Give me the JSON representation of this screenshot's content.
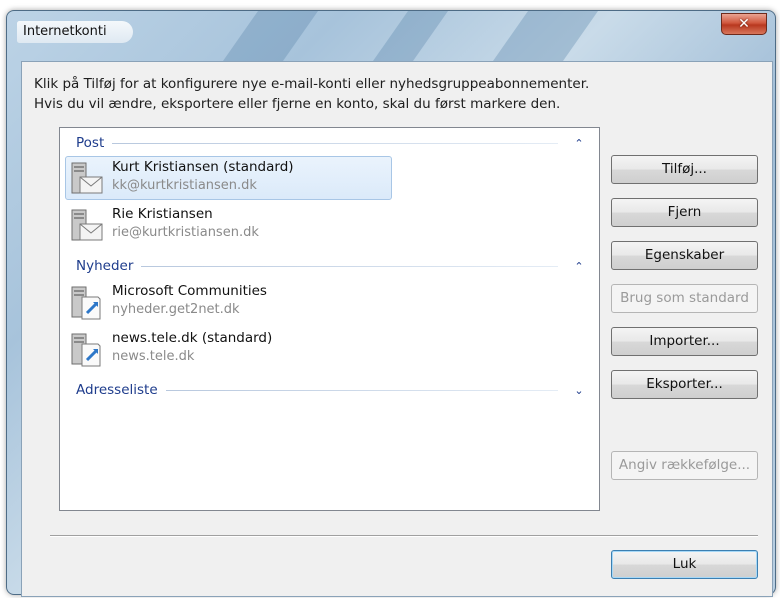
{
  "window": {
    "title": "Internetkonti",
    "close_glyph": "✕"
  },
  "intro": {
    "line1": "Klik på Tilføj for at konfigurere nye e-mail-konti eller nyhedsgruppeabonnementer.",
    "line2": "Hvis du vil ændre, eksportere eller fjerne en konto, skal du først markere den."
  },
  "groups": {
    "post": {
      "title": "Post",
      "chevron": "⌃",
      "chevron_icon": "chevron-up-icon",
      "items": [
        {
          "name": "Kurt Kristiansen (standard)",
          "sub": "kk@kurtkristiansen.dk",
          "icon": "mail-account-icon",
          "selected": true
        },
        {
          "name": "Rie Kristiansen",
          "sub": "rie@kurtkristiansen.dk",
          "icon": "mail-account-icon",
          "selected": false
        }
      ]
    },
    "news": {
      "title": "Nyheder",
      "chevron": "⌃",
      "chevron_icon": "chevron-up-icon",
      "items": [
        {
          "name": "Microsoft Communities",
          "sub": "nyheder.get2net.dk",
          "icon": "news-server-icon",
          "selected": false
        },
        {
          "name": "news.tele.dk (standard)",
          "sub": "news.tele.dk",
          "icon": "news-server-icon",
          "selected": false
        }
      ]
    },
    "directory": {
      "title": "Adresseliste",
      "chevron": "⌄",
      "chevron_icon": "chevron-down-icon"
    }
  },
  "buttons": {
    "add": "Tilføj...",
    "remove": "Fjern",
    "properties": "Egenskaber",
    "set_default": "Brug som standard",
    "import": "Importer...",
    "export": "Eksporter...",
    "order": "Angiv rækkefølge...",
    "close": "Luk"
  },
  "colors": {
    "group_header": "#1e3c8c",
    "selection": "#dbeafa",
    "close_button": "#c84a30"
  }
}
